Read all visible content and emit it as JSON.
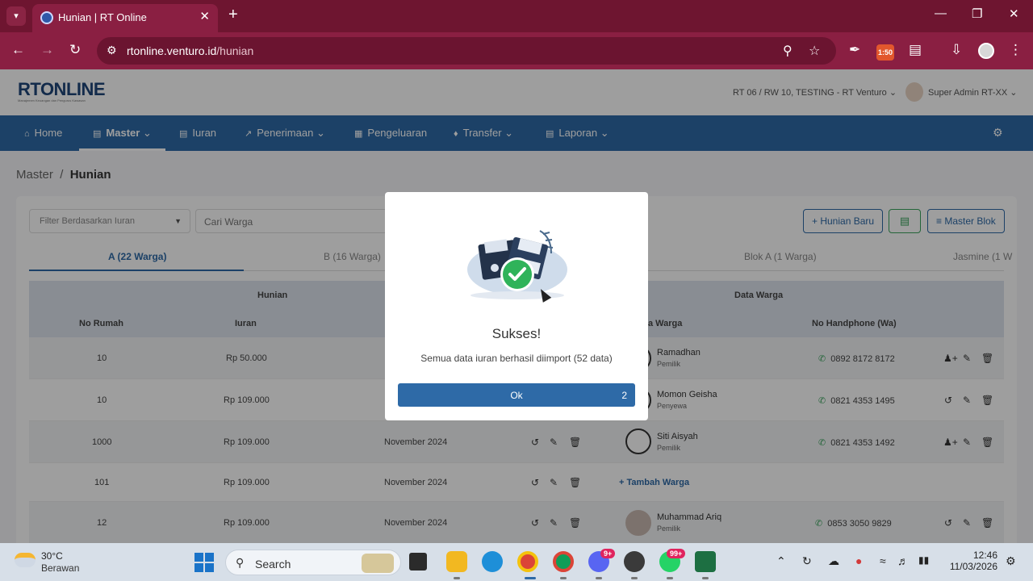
{
  "browser": {
    "tab_title": "Hunian | RT Online",
    "url_domain": "rtonline.venturo.id",
    "url_path": "/hunian",
    "ext_badge": "1:50"
  },
  "app": {
    "logo_main": "RT",
    "logo_rest": "ONLINE",
    "logo_tagline": "Manajemen Keuangan dan Pengurus Kawasan",
    "rt_select": "RT 06 / RW 10, TESTING - RT Venturo",
    "user_name": "Super Admin RT-XX"
  },
  "nav": {
    "home": "Home",
    "master": "Master",
    "iuran": "Iuran",
    "penerimaan": "Penerimaan",
    "pengeluaran": "Pengeluaran",
    "transfer": "Transfer",
    "laporan": "Laporan"
  },
  "breadcrumb": {
    "parent": "Master",
    "separator": "/",
    "current": "Hunian"
  },
  "toolbar": {
    "filter_placeholder": "Filter Berdasarkan Iuran",
    "search_placeholder": "Cari Warga",
    "hunian_baru": "Hunian Baru",
    "master_blok": "Master Blok"
  },
  "blok_tabs": [
    "A (22 Warga)",
    "B (16 Warga)",
    "Blok A (1 Warga)",
    "Jasmine (1 W"
  ],
  "table": {
    "group_hunian": "Hunian",
    "group_warga": "Data Warga",
    "col_no_rumah": "No Rumah",
    "col_iuran": "Iuran",
    "col_nama_warga": "a Warga",
    "col_no_hp": "No Handphone (Wa)",
    "rows": [
      {
        "no": "10",
        "iuran": "Rp 50.000",
        "periode": "",
        "nama": "Ramadhan",
        "role": "Pemilik",
        "hp": "0892 8172 8172"
      },
      {
        "no": "10",
        "iuran": "Rp 109.000",
        "periode": "",
        "nama": "Momon Geisha",
        "role": "Penyewa",
        "hp": "0821 4353 1495"
      },
      {
        "no": "1000",
        "iuran": "Rp 109.000",
        "periode": "November 2024",
        "nama": "Siti Aisyah",
        "role": "Pemilik",
        "hp": "0821 4353 1492"
      },
      {
        "no": "101",
        "iuran": "Rp 109.000",
        "periode": "November 2024",
        "tambah": "+ Tambah Warga"
      },
      {
        "no": "12",
        "iuran": "Rp 109.000",
        "periode": "November 2024",
        "nama": "Muhammad Ariq",
        "role": "Pemilik",
        "hp": "0853 3050 9829"
      }
    ]
  },
  "modal": {
    "title": "Sukses!",
    "message": "Semua data iuran berhasil diimport (52 data)",
    "ok_label": "Ok",
    "ok_count": "2"
  },
  "taskbar": {
    "temperature": "30°C",
    "condition": "Berawan",
    "search_label": "Search",
    "badge_discord": "9+",
    "badge_whatsapp": "99+",
    "time": "12:46",
    "date": "11/03/2026"
  },
  "colors": {
    "chrome_tab": "#6e1530",
    "chrome_toolbar": "#8a1f42",
    "nav_blue": "#2e6aa7",
    "success_green": "#3aa35c"
  }
}
